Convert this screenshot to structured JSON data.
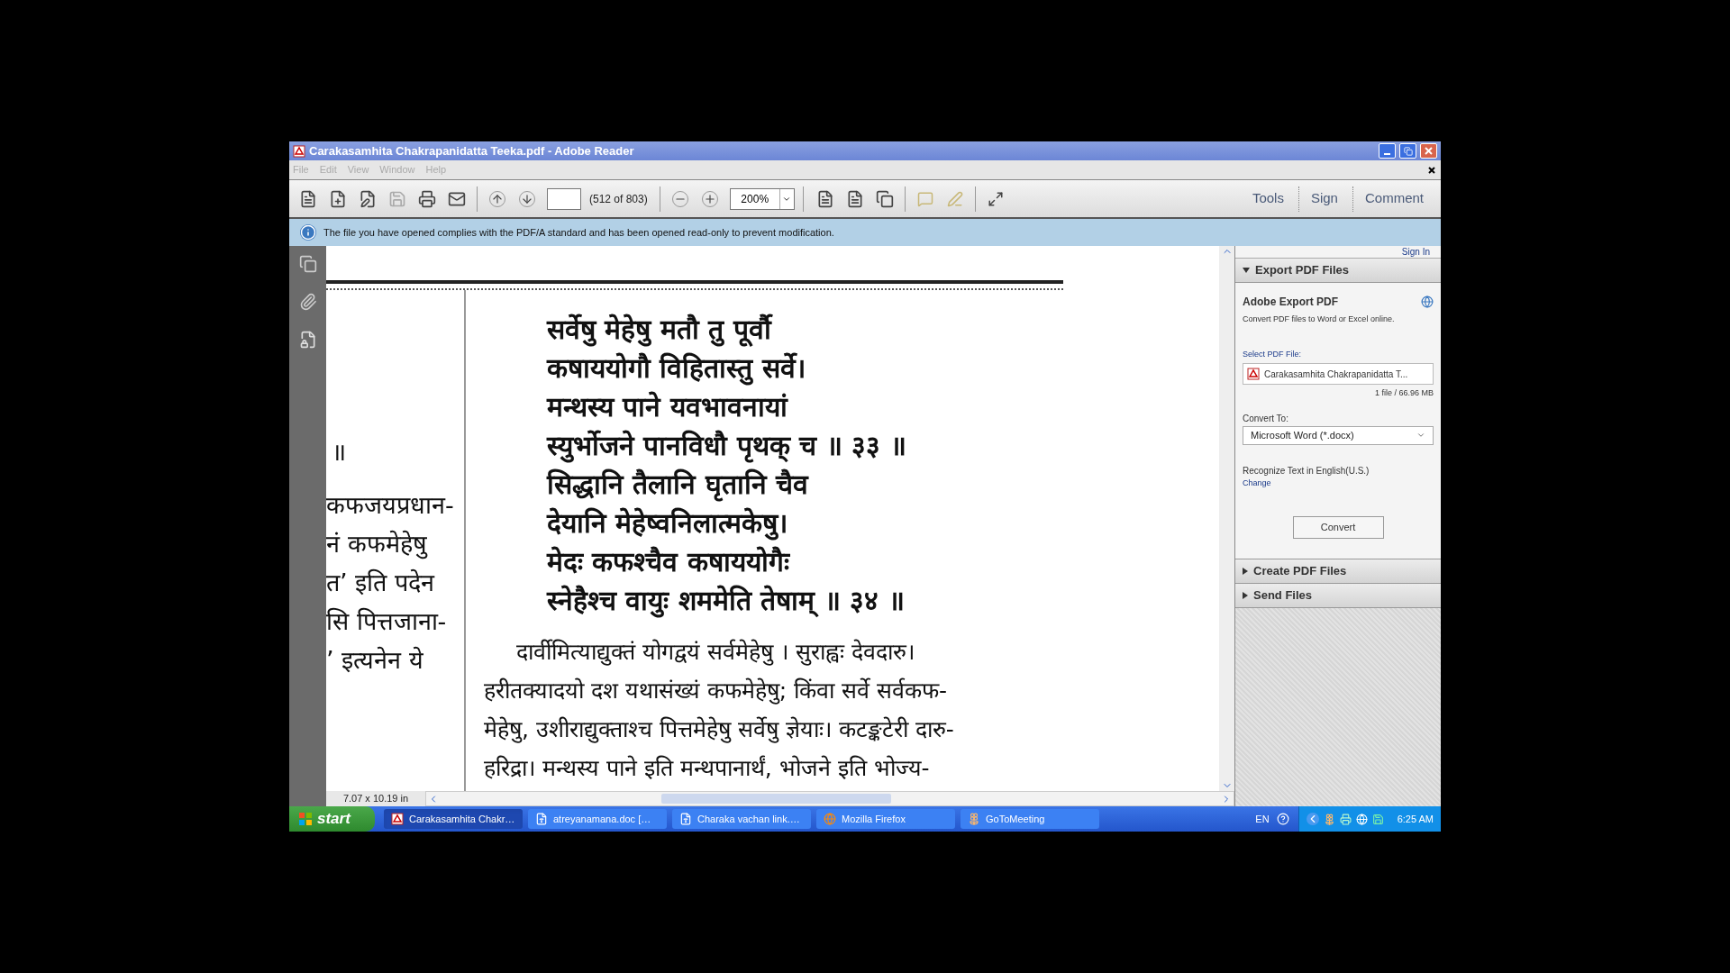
{
  "window": {
    "title": "Carakasamhita Chakrapanidatta Teeka.pdf - Adobe Reader"
  },
  "menu": [
    "File",
    "Edit",
    "View",
    "Window",
    "Help"
  ],
  "toolbar": {
    "page_count": "(512 of 803)",
    "zoom": "200%",
    "actions": [
      "Tools",
      "Sign",
      "Comment"
    ]
  },
  "info_bar": {
    "message": "The file you have opened complies with the PDF/A standard and has been opened read-only to prevent modification."
  },
  "document": {
    "left_column": [
      "॥",
      "कफजयप्रधान-",
      "नं  कफमेहेषु",
      "त’ इति पदेन",
      "सि पित्तजाना-",
      "’ इत्यनेन ये"
    ],
    "verses": [
      "सर्वेषु मेहेषु मतौ तु पूर्वौ",
      "कषाययोगौ विहितास्तु सर्वे।",
      "मन्थस्य पाने यवभावनायां",
      "स्युर्भोजने पानविधौ पृथक् च ॥ ३३ ॥",
      "सिद्धानि तैलानि घृतानि चैव",
      "देयानि मेहेष्वनिलात्मकेषु।",
      "मेदः कफश्चैव कषाययोगैः",
      "स्नेहैश्च वायुः शममेति तेषाम् ॥ ३४ ॥"
    ],
    "commentary": [
      "दार्वीमित्याद्युक्तं योगद्वयं सर्वमेहेषु । सुराह्वः देवदारु।",
      "हरीतक्यादयो दश यथासंख्यं कफमेहेषु; किंवा सर्वे सर्वकफ-",
      "मेहेषु, उशीराद्युक्ताश्च पित्तमेहेषु सर्वेषु ज्ञेयाः। कटङ्कटेरी दारु-",
      "हरिद्रा। मन्थस्य पाने इति मन्थपानार्थं, भोजने इति भोज्य-"
    ]
  },
  "status": {
    "page_size": "7.07 x 10.19 in"
  },
  "right_panel": {
    "sign_in": "Sign In",
    "sections": [
      {
        "title": "Export PDF Files",
        "expanded": true
      },
      {
        "title": "Create PDF Files",
        "expanded": false
      },
      {
        "title": "Send Files",
        "expanded": false
      }
    ],
    "export": {
      "title": "Adobe Export PDF",
      "description": "Convert PDF files to Word or Excel online.",
      "file_label": "Select PDF File:",
      "file_name": "Carakasamhita Chakrapanidatta T...",
      "file_size": "1 file / 66.96 MB",
      "convert_label": "Convert To:",
      "format": "Microsoft Word (*.docx)",
      "ocr_text": "Recognize Text in English(U.S.)",
      "change_link": "Change",
      "button": "Convert"
    }
  },
  "taskbar": {
    "start": "start",
    "tasks": [
      {
        "label": "Carakasamhita Chakr…",
        "kind": "pdf",
        "selected": true
      },
      {
        "label": "atreyanamana.doc […",
        "kind": "word",
        "selected": false
      },
      {
        "label": "Charaka vachan link.…",
        "kind": "word",
        "selected": false
      },
      {
        "label": "Mozilla Firefox",
        "kind": "firefox",
        "selected": false
      },
      {
        "label": "GoToMeeting",
        "kind": "meeting",
        "selected": false
      }
    ],
    "language": "EN",
    "clock": "6:25 AM"
  }
}
